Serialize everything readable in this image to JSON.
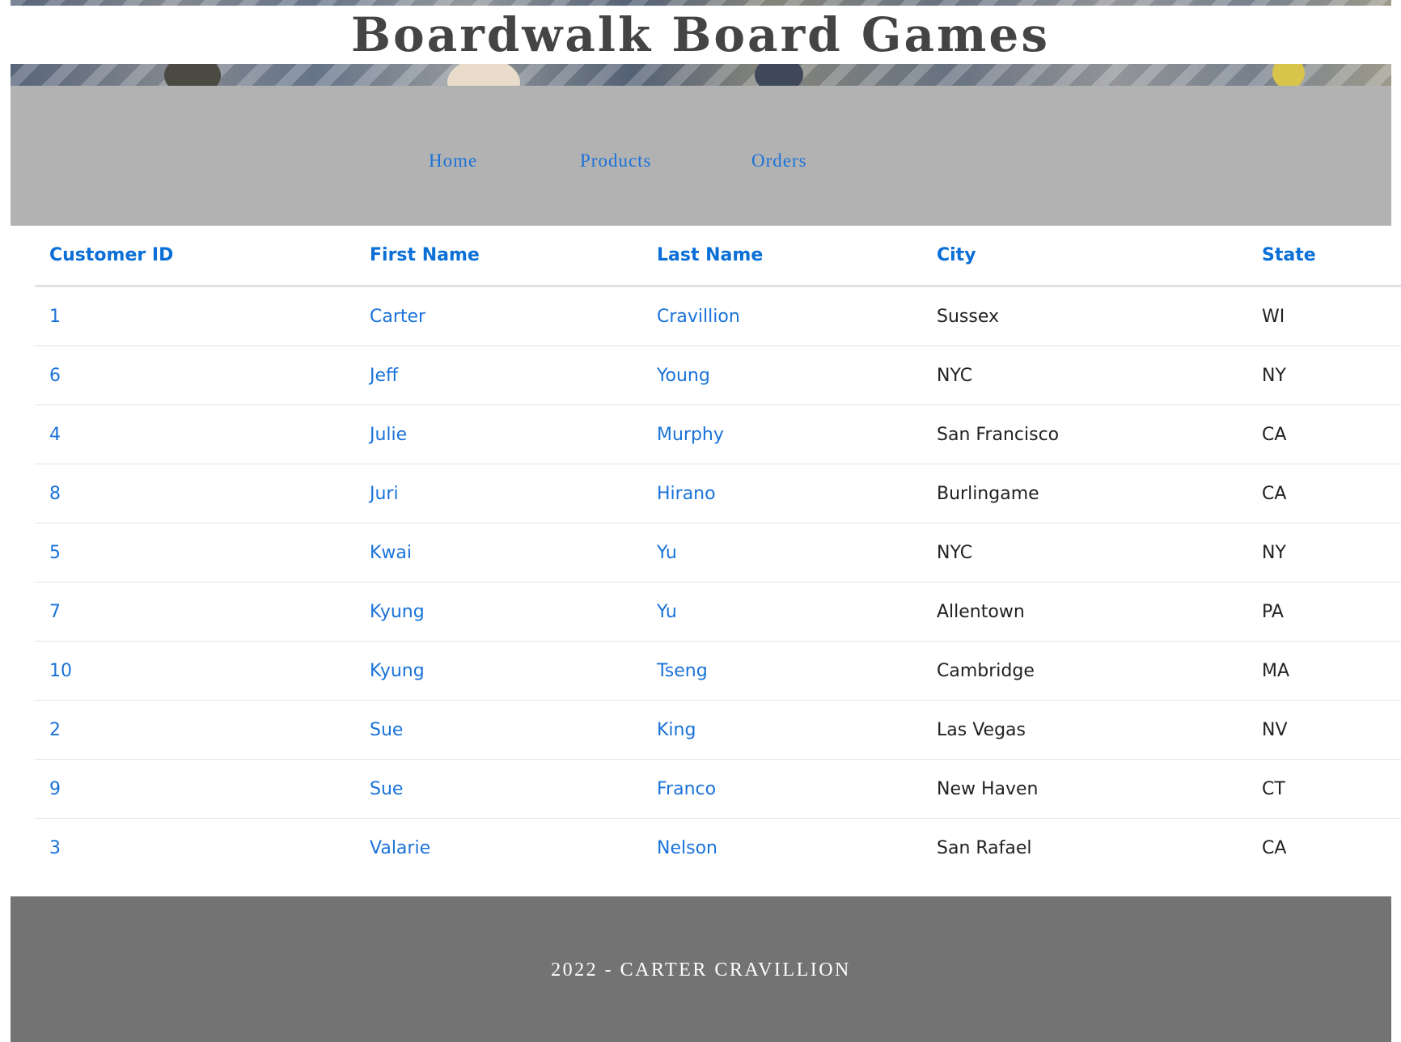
{
  "site": {
    "title": "Boardwalk Board Games"
  },
  "nav": {
    "items": [
      {
        "label": "Home"
      },
      {
        "label": "Products"
      },
      {
        "label": "Orders"
      }
    ],
    "link_color": "#1a73d9",
    "background": "#b2b2b2"
  },
  "table": {
    "headers": [
      "Customer ID",
      "First Name",
      "Last Name",
      "City",
      "State"
    ],
    "rows": [
      [
        "1",
        "Carter",
        "Cravillion",
        "Sussex",
        "WI"
      ],
      [
        "6",
        "Jeff",
        "Young",
        "NYC",
        "NY"
      ],
      [
        "4",
        "Julie",
        "Murphy",
        "San Francisco",
        "CA"
      ],
      [
        "8",
        "Juri",
        "Hirano",
        "Burlingame",
        "CA"
      ],
      [
        "5",
        "Kwai",
        "Yu",
        "NYC",
        "NY"
      ],
      [
        "7",
        "Kyung",
        "Yu",
        "Allentown",
        "PA"
      ],
      [
        "10",
        "Kyung",
        "Tseng",
        "Cambridge",
        "MA"
      ],
      [
        "2",
        "Sue",
        "King",
        "Las Vegas",
        "NV"
      ],
      [
        "9",
        "Sue",
        "Franco",
        "New Haven",
        "CT"
      ],
      [
        "3",
        "Valarie",
        "Nelson",
        "San Rafael",
        "CA"
      ]
    ],
    "header_color": "#0a6fd6"
  },
  "footer": {
    "text": "2022 - CARTER CRAVILLION",
    "background": "#737373"
  }
}
